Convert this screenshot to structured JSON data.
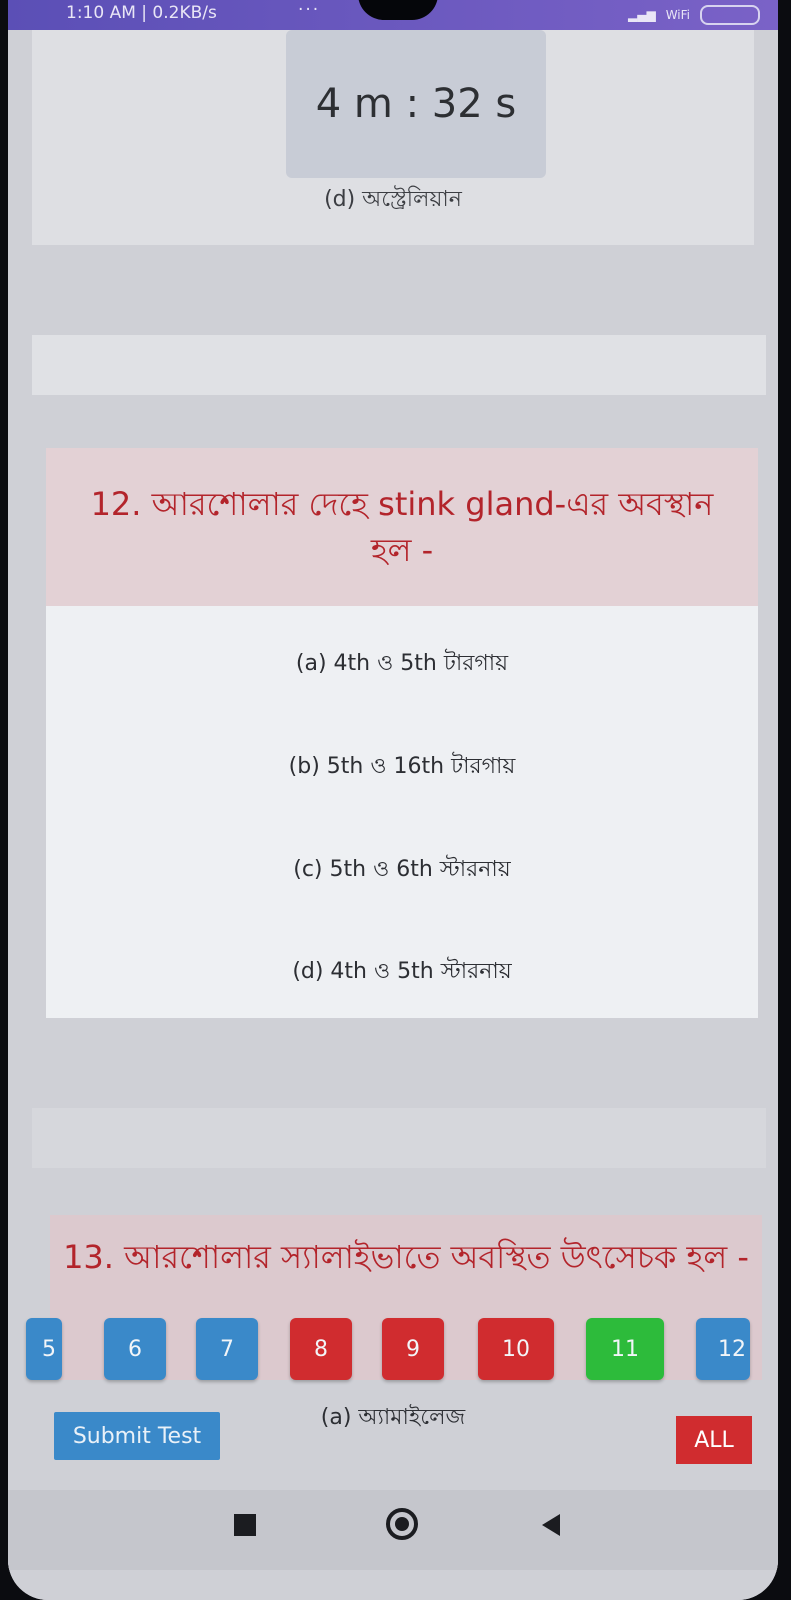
{
  "status_bar": {
    "time": "1:10 AM | 0.2KB/s",
    "dots": "···",
    "wifi_label": "WiFi"
  },
  "timer": {
    "value": "4 m : 32 s"
  },
  "previous_question": {
    "option_d": "(d) অস্ট্রেলিয়ান"
  },
  "question_12": {
    "title": "12. আরশোলার দেহে stink gland-এর অবস্থান হল -",
    "options": [
      "(a) 4th ও 5th টারগায়",
      "(b) 5th ও 16th টারগায়",
      "(c) 5th ও 6th স্টারনায়",
      "(d) 4th ও 5th স্টারনায়"
    ]
  },
  "question_13": {
    "title": "13. আরশোলার স্যালাইভাতে অবস্থিত উৎসেচক হল -",
    "option_a": "(a) অ্যামাইলেজ"
  },
  "question_nav": {
    "buttons": [
      {
        "label": "5",
        "color": "#3a89c9"
      },
      {
        "label": "6",
        "color": "#3a89c9"
      },
      {
        "label": "7",
        "color": "#3a89c9"
      },
      {
        "label": "8",
        "color": "#d02c2f"
      },
      {
        "label": "9",
        "color": "#d02c2f"
      },
      {
        "label": "10",
        "color": "#d02c2f"
      },
      {
        "label": "11",
        "color": "#2dbb3b"
      },
      {
        "label": "12",
        "color": "#3a89c9"
      }
    ]
  },
  "actions": {
    "submit_label": "Submit Test",
    "all_label": "ALL"
  }
}
